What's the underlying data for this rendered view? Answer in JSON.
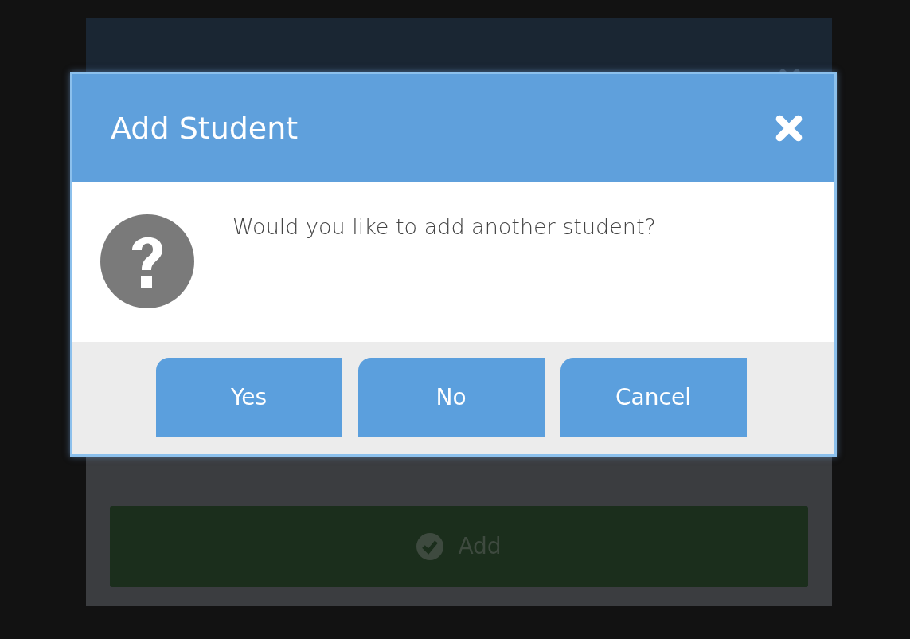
{
  "background_dialog": {
    "add_button": {
      "label": "Add"
    }
  },
  "modal": {
    "title": "Add Student",
    "message": "Would you like to add another student?",
    "buttons": [
      {
        "label": "Yes"
      },
      {
        "label": "No"
      },
      {
        "label": "Cancel"
      }
    ]
  }
}
